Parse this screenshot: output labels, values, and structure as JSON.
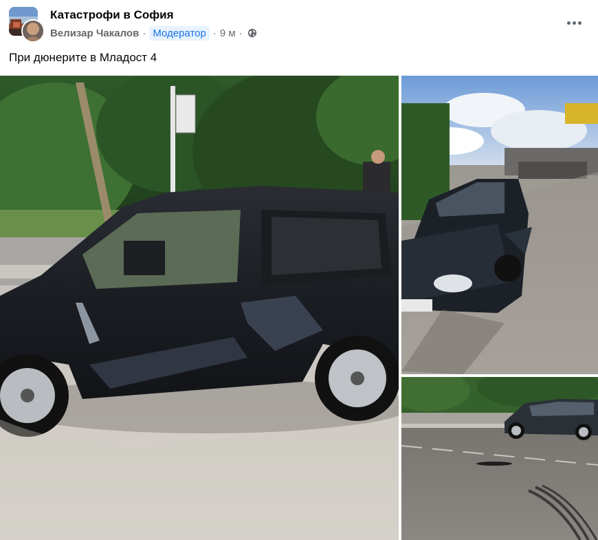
{
  "post": {
    "group_name": "Катастрофи в София",
    "author": "Велизар Чакалов",
    "role_badge": "Модератор",
    "separator": "·",
    "time": "9 м",
    "privacy_icon": "globe-icon",
    "menu_icon": "more-options-icon",
    "text": "При дюнерите в Младост 4"
  },
  "photos": [
    {
      "description_icon": "damaged-car-side-photo"
    },
    {
      "description_icon": "car-front-photo"
    },
    {
      "description_icon": "road-with-car-photo"
    }
  ],
  "colors": {
    "badge_bg": "#e7f3ff",
    "badge_text": "#1b74e4",
    "secondary_text": "#65676b"
  }
}
